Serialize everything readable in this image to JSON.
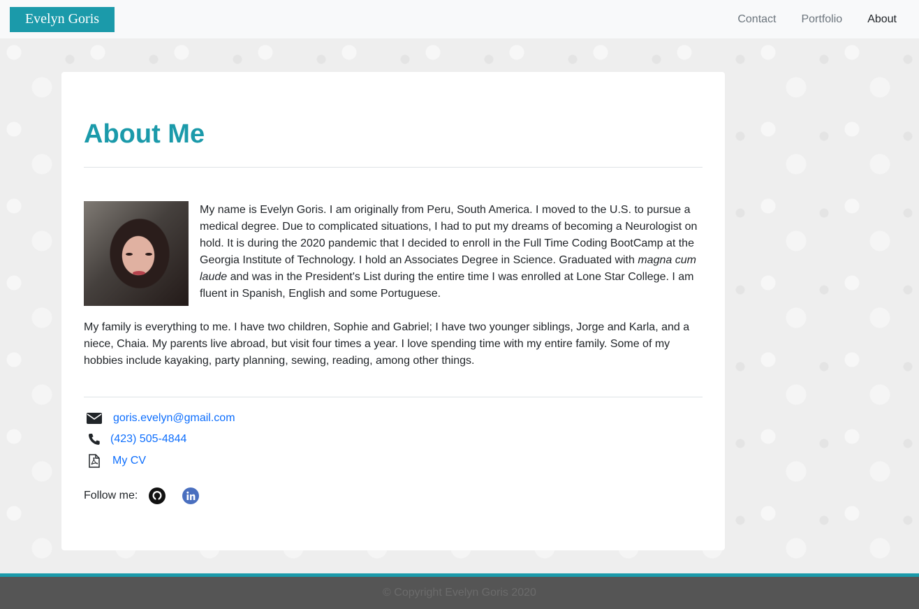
{
  "nav": {
    "brand": "Evelyn Goris",
    "links": [
      {
        "label": "Contact"
      },
      {
        "label": "Portfolio"
      },
      {
        "label": "About"
      }
    ]
  },
  "main": {
    "title": "About Me",
    "paragraph1_a": "My name is Evelyn Goris. I am originally from Peru, South America. I moved to the U.S. to pursue a medical degree. Due to complicated situations, I had to put my dreams of becoming a Neurologist on hold. It is during the 2020 pandemic that I decided to enroll in the Full Time Coding BootCamp at the Georgia Institute of Technology. I hold an Associates Degree in Science. Graduated with",
    "paragraph1_em": "magna cum laude",
    "paragraph1_b": "and was in the President's List during the entire time I was enrolled at Lone Star College. I am fluent in Spanish, English and some Portuguese.",
    "paragraph2": "My family is everything to me. I have two children, Sophie and Gabriel; I have two younger siblings, Jorge and Karla, and a niece, Chaia. My parents live abroad, but visit four times a year. I love spending time with my entire family. Some of my hobbies include kayaking, party planning, sewing, reading, among other things.",
    "contact": {
      "email": "goris.evelyn@gmail.com",
      "phone": "(423) 505-4844",
      "cv": "My CV"
    },
    "follow_label": "Follow me:",
    "social_icons": [
      "github-icon",
      "linkedin-icon"
    ]
  },
  "footer": {
    "copyright": "© Copyright Evelyn Goris 2020"
  },
  "colors": {
    "accent": "#1b9aaa",
    "link": "#0d6efd",
    "linkedin": "#4a6fbf"
  }
}
